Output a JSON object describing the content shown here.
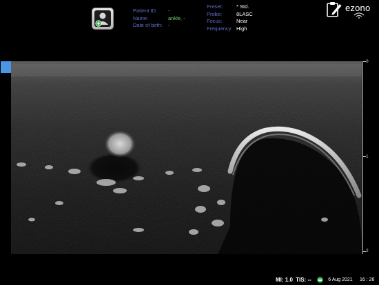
{
  "patient": {
    "labels": {
      "id": "Patient ID:",
      "name": "Name:",
      "dob": "Date of birth:"
    },
    "values": {
      "id": "-",
      "name": "ankle, -",
      "dob": "-"
    }
  },
  "probe": {
    "labels": {
      "preset": "Preset:",
      "probe": "Probe:",
      "focus": "Focus:",
      "frequency": "Frequency:"
    },
    "values": {
      "preset": "* Std.",
      "probe": "8LASC",
      "focus": "Near",
      "frequency": "High"
    }
  },
  "brand": {
    "logo_text": "ezono"
  },
  "icons": {
    "patient_button": "patient-profile-icon",
    "clipboard": "clipboard-edit-icon",
    "wifi": "wifi-icon",
    "status": "sync-status-icon"
  },
  "depth_scale": {
    "labels": [
      "0",
      "1",
      "2"
    ]
  },
  "status_bar": {
    "mi": "MI: 1.0",
    "tis": "TIS: --",
    "date": "6 Aug 2021",
    "time": "16 : 26"
  },
  "colors": {
    "label_blue": "#5d6fc8",
    "value_green": "#6ecf6e",
    "marker_blue": "#4b97e6",
    "status_green": "#3cb44a"
  }
}
